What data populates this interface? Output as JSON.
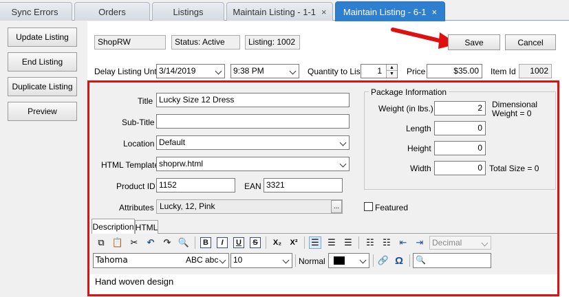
{
  "tabs": [
    {
      "label": "Sync Errors"
    },
    {
      "label": "Orders"
    },
    {
      "label": "Listings"
    },
    {
      "label": "Maintain Listing - 1-1"
    },
    {
      "label": "Maintain Listing - 6-1"
    }
  ],
  "actions": {
    "update": "Update Listing",
    "end": "End Listing",
    "duplicate": "Duplicate Listing",
    "preview": "Preview"
  },
  "header": {
    "store": "ShopRW",
    "status": "Status: Active",
    "listing": "Listing: 1002",
    "save": "Save",
    "cancel": "Cancel"
  },
  "schedule": {
    "delay_label": "Delay Listing Until",
    "date": "3/14/2019",
    "time": "9:38 PM",
    "qty_label": "Quantity to List",
    "qty": "1",
    "price_label": "Price",
    "price": "$35.00",
    "item_id_label": "Item Id",
    "item_id": "1002"
  },
  "form": {
    "title_label": "Title",
    "title": "Lucky Size 12 Dress",
    "subtitle_label": "Sub-Title",
    "subtitle": "",
    "location_label": "Location",
    "location": "Default",
    "template_label": "HTML Template",
    "template": "shoprw.html",
    "product_id_label": "Product ID",
    "product_id": "1152",
    "ean_label": "EAN",
    "ean": "3321",
    "attributes_label": "Attributes",
    "attributes": "Lucky, 12, Pink",
    "ellipsis": "...",
    "featured_label": "Featured"
  },
  "package": {
    "title": "Package Information",
    "weight_label": "Weight (in lbs.)",
    "weight": "2",
    "length_label": "Length",
    "length": "0",
    "height_label": "Height",
    "height": "0",
    "width_label": "Width",
    "width": "0",
    "dim_weight": "Dimensional",
    "dim_weight2": "Weight = 0",
    "total_size": "Total Size = 0"
  },
  "editor": {
    "tab_description": "Description",
    "tab_html": "HTML",
    "font": "Tahoma",
    "font_preview": "ABC abc",
    "size": "10",
    "style": "Normal",
    "list_style": "Decimal",
    "content": "Hand woven design",
    "color": "#000000"
  }
}
